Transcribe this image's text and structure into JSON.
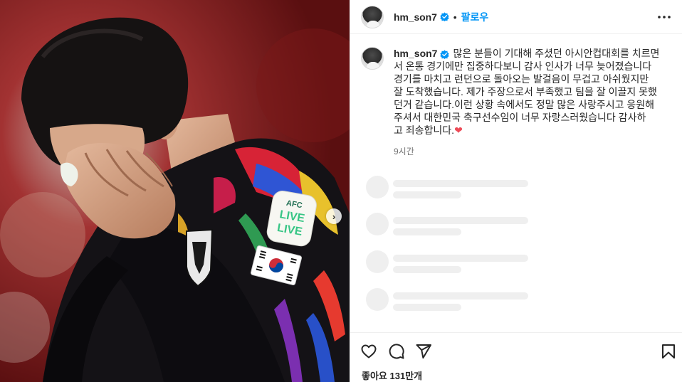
{
  "post": {
    "username": "hm_son7",
    "separator": "•",
    "follow_label": "팔로우",
    "caption_lines": [
      "많은 분들이 기대해 주셨던 아시안컵대회를 치르면",
      "서 온통 경기에만 집중하다보니 감사 인사가 너무 늦어졌습니다",
      "경기를 마치고 런던으로 돌아오는 발걸음이 무겁고 아쉬웠지만",
      "잘 도착했습니다. 제가 주장으로서 부족했고 팀을 잘 이끌지 못했",
      "던거 같습니다.이런 상황 속에서도 정말 많은 사랑주시고 응원해",
      "주셔서  대한민국 축구선수임이 너무 자랑스러웠습니다  감사하",
      "고 죄송합니다."
    ],
    "heart_glyph": "❤",
    "time_ago": "9시간",
    "likes_text": "좋아요 131만개"
  },
  "photo": {
    "patch_top": "AFC",
    "patch_middle": "LIVE",
    "patch_bottom": "LIVE",
    "next_arrow": "›"
  },
  "icons": {
    "verified": "verified-badge-icon",
    "more": "more-options-icon",
    "like": "heart-icon",
    "comment": "comment-icon",
    "share": "send-icon",
    "save": "bookmark-icon"
  },
  "colors": {
    "accent": "#0095f6",
    "text": "#262626",
    "muted": "#737373",
    "heart": "#ed4956",
    "skeleton": "#efefef"
  }
}
